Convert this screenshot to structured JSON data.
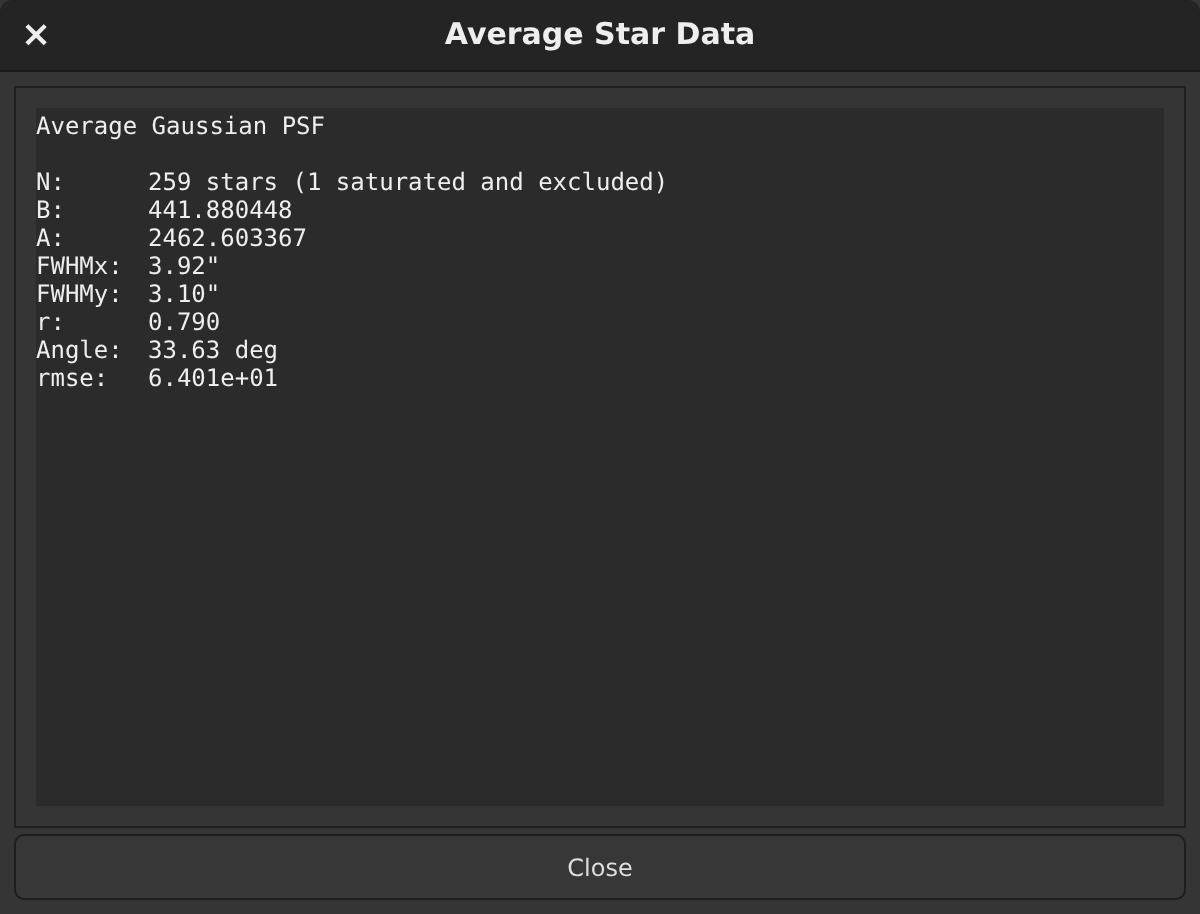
{
  "window": {
    "title": "Average Star Data",
    "close_icon": "×"
  },
  "report": {
    "heading": "Average Gaussian PSF",
    "rows": [
      {
        "label": "N:",
        "value": "259 stars (1 saturated and excluded)"
      },
      {
        "label": "B:",
        "value": "441.880448"
      },
      {
        "label": "A:",
        "value": "2462.603367"
      },
      {
        "label": "FWHMx:",
        "value": "3.92\""
      },
      {
        "label": "FWHMy:",
        "value": "3.10\""
      },
      {
        "label": "r:",
        "value": "0.790"
      },
      {
        "label": "Angle:",
        "value": "33.63 deg"
      },
      {
        "label": "rmse:",
        "value": "6.401e+01"
      }
    ]
  },
  "buttons": [
    "Close"
  ]
}
